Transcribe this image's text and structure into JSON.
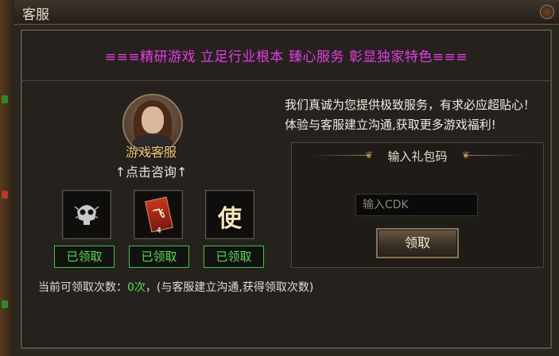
{
  "window": {
    "title": "客服"
  },
  "slogan": "≡≡≡精研游戏  立足行业根本  臻心服务  彰显独家特色≡≡≡",
  "service": {
    "name": "游戏客服",
    "consult": "↑点击咨询↑"
  },
  "rewards": [
    {
      "icon": "skull-icon",
      "claimed_label": "已领取"
    },
    {
      "icon": "red-book-icon",
      "glyph": "飞",
      "count": "4",
      "claimed_label": "已领取"
    },
    {
      "icon": "envoy-char-icon",
      "glyph": "使",
      "claimed_label": "已领取"
    }
  ],
  "claim_count": {
    "prefix": "当前可领取次数：",
    "value": "0次",
    "suffix": "，(与客服建立沟通,获得领取次数)"
  },
  "intro": {
    "line1": "我们真诚为您提供极致服务，有求必应超贴心！",
    "line2": "体验与客服建立沟通,获取更多游戏福利!"
  },
  "gift": {
    "title": "输入礼包码",
    "input_placeholder": "输入CDK",
    "button_label": "领取"
  },
  "colors": {
    "slogan": "#e63be6",
    "claimed_green": "#39c93c",
    "service_name_gold": "#f2c97a"
  }
}
